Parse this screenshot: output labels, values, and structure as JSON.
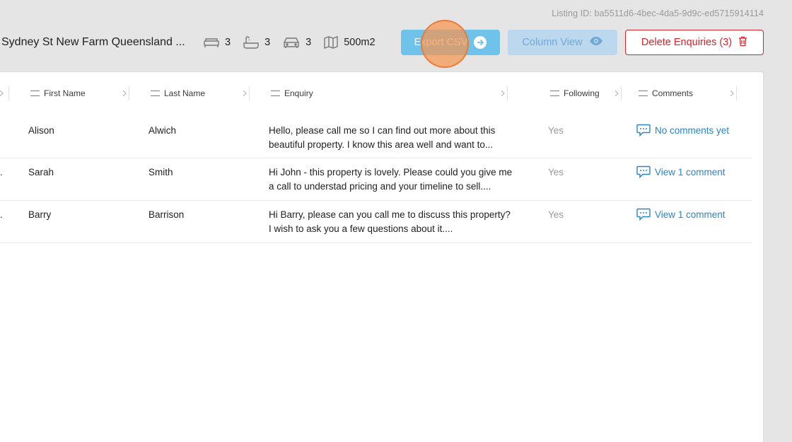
{
  "listing": {
    "id_text": "Listing ID: ba5511d6-4bec-4da5-9d9c-ed5715914114",
    "address": "Sydney St New Farm Queensland ...",
    "features": [
      {
        "icon": "bed-icon",
        "value": "3"
      },
      {
        "icon": "bath-icon",
        "value": "3"
      },
      {
        "icon": "car-icon",
        "value": "3"
      },
      {
        "icon": "land-area-icon",
        "value": "500m2"
      }
    ]
  },
  "toolbar": {
    "export_label": "Export CSV",
    "column_view_label": "Column View",
    "delete_label": "Delete Enquiries (3)"
  },
  "table": {
    "columns": [
      {
        "label": "First Name"
      },
      {
        "label": "Last Name"
      },
      {
        "label": "Enquiry"
      },
      {
        "label": "Following"
      },
      {
        "label": "Comments"
      }
    ],
    "rows": [
      {
        "lead": "",
        "first_name": "Alison",
        "last_name": "Alwich",
        "enquiry": "Hello, please call me so I can find out more about this beautiful property. I know this area well and want to...",
        "following": "Yes",
        "comment": "No comments yet"
      },
      {
        "lead": ".",
        "first_name": "Sarah",
        "last_name": "Smith",
        "enquiry": "Hi John - this property is lovely. Please could you give me a call to understad pricing and your timeline to sell....",
        "following": "Yes",
        "comment": "View 1 comment"
      },
      {
        "lead": ".",
        "first_name": "Barry",
        "last_name": "Barrison",
        "enquiry": "Hi Barry, please can you call me to discuss this property? I wish to ask you a few questions about it....",
        "following": "Yes",
        "comment": "View 1 comment"
      }
    ]
  },
  "colors": {
    "accent_blue": "#2a85c6",
    "export_button": "#6fc3ea",
    "column_view_button": "#bcd8ef",
    "danger_red": "#d8232a",
    "click_indicator": "#f59650"
  }
}
